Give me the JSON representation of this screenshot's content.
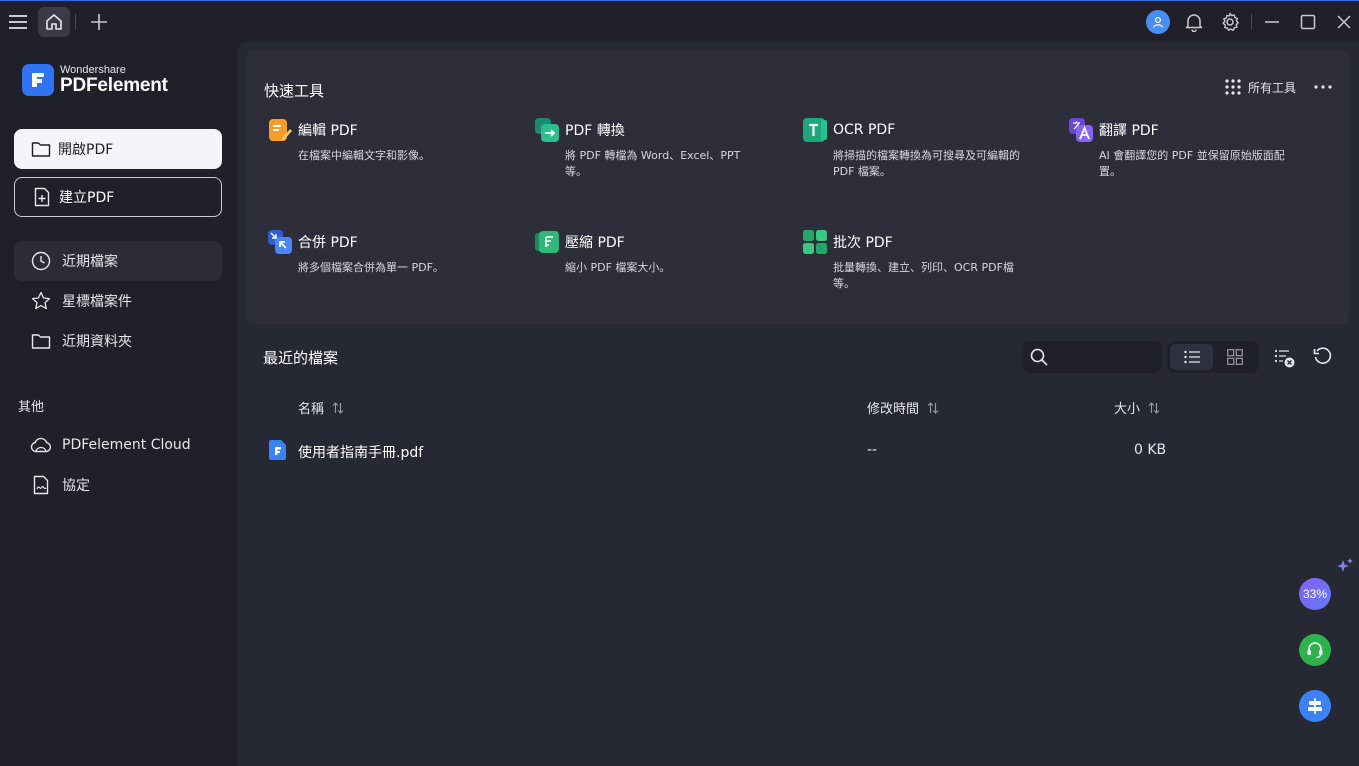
{
  "app": {
    "brand_small": "Wondershare",
    "brand_big": "PDFelement"
  },
  "colors": {
    "accent": "#2f74f5",
    "background": "#1f2029",
    "panel": "#2d2e3a"
  },
  "sidebar": {
    "open_label": "開啟PDF",
    "create_label": "建立PDF",
    "nav": [
      {
        "label": "近期檔案",
        "icon": "clock-icon",
        "active": true
      },
      {
        "label": "星標檔案件",
        "icon": "star-icon",
        "active": false
      },
      {
        "label": "近期資料夾",
        "icon": "folder-icon",
        "active": false
      }
    ],
    "other_label": "其他",
    "other": [
      {
        "label": "PDFelement Cloud",
        "icon": "cloud-icon"
      },
      {
        "label": "協定",
        "icon": "agreement-icon"
      }
    ]
  },
  "quick_tools": {
    "title": "快速工具",
    "all_tools_label": "所有工具",
    "tools": [
      {
        "name": "編輯 PDF",
        "desc": "在檔案中編輯文字和影像。",
        "icon": "edit-pdf-icon"
      },
      {
        "name": "PDF 轉換",
        "desc": "將 PDF 轉檔為 Word、Excel、PPT 等。",
        "icon": "convert-pdf-icon"
      },
      {
        "name": "OCR PDF",
        "desc": "將掃描的檔案轉換為可搜尋及可編輯的 PDF 檔案。",
        "icon": "ocr-pdf-icon"
      },
      {
        "name": "翻譯 PDF",
        "desc": "AI 會翻譯您的 PDF 並保留原始版面配置。",
        "icon": "translate-pdf-icon"
      },
      {
        "name": "合併 PDF",
        "desc": "將多個檔案合併為單一 PDF。",
        "icon": "merge-pdf-icon"
      },
      {
        "name": "壓縮 PDF",
        "desc": "縮小 PDF 檔案大小。",
        "icon": "compress-pdf-icon"
      },
      {
        "name": "批次 PDF",
        "desc": "批量轉換、建立、列印、OCR PDF檔等。",
        "icon": "batch-pdf-icon"
      }
    ]
  },
  "recent": {
    "title": "最近的檔案",
    "search_placeholder": "",
    "columns": {
      "name": "名稱",
      "modified": "修改時間",
      "size": "大小"
    },
    "files": [
      {
        "name": "使用者指南手冊.pdf",
        "modified": "--",
        "size": "0 KB"
      }
    ]
  },
  "floating": {
    "ai_percent": "33%"
  }
}
